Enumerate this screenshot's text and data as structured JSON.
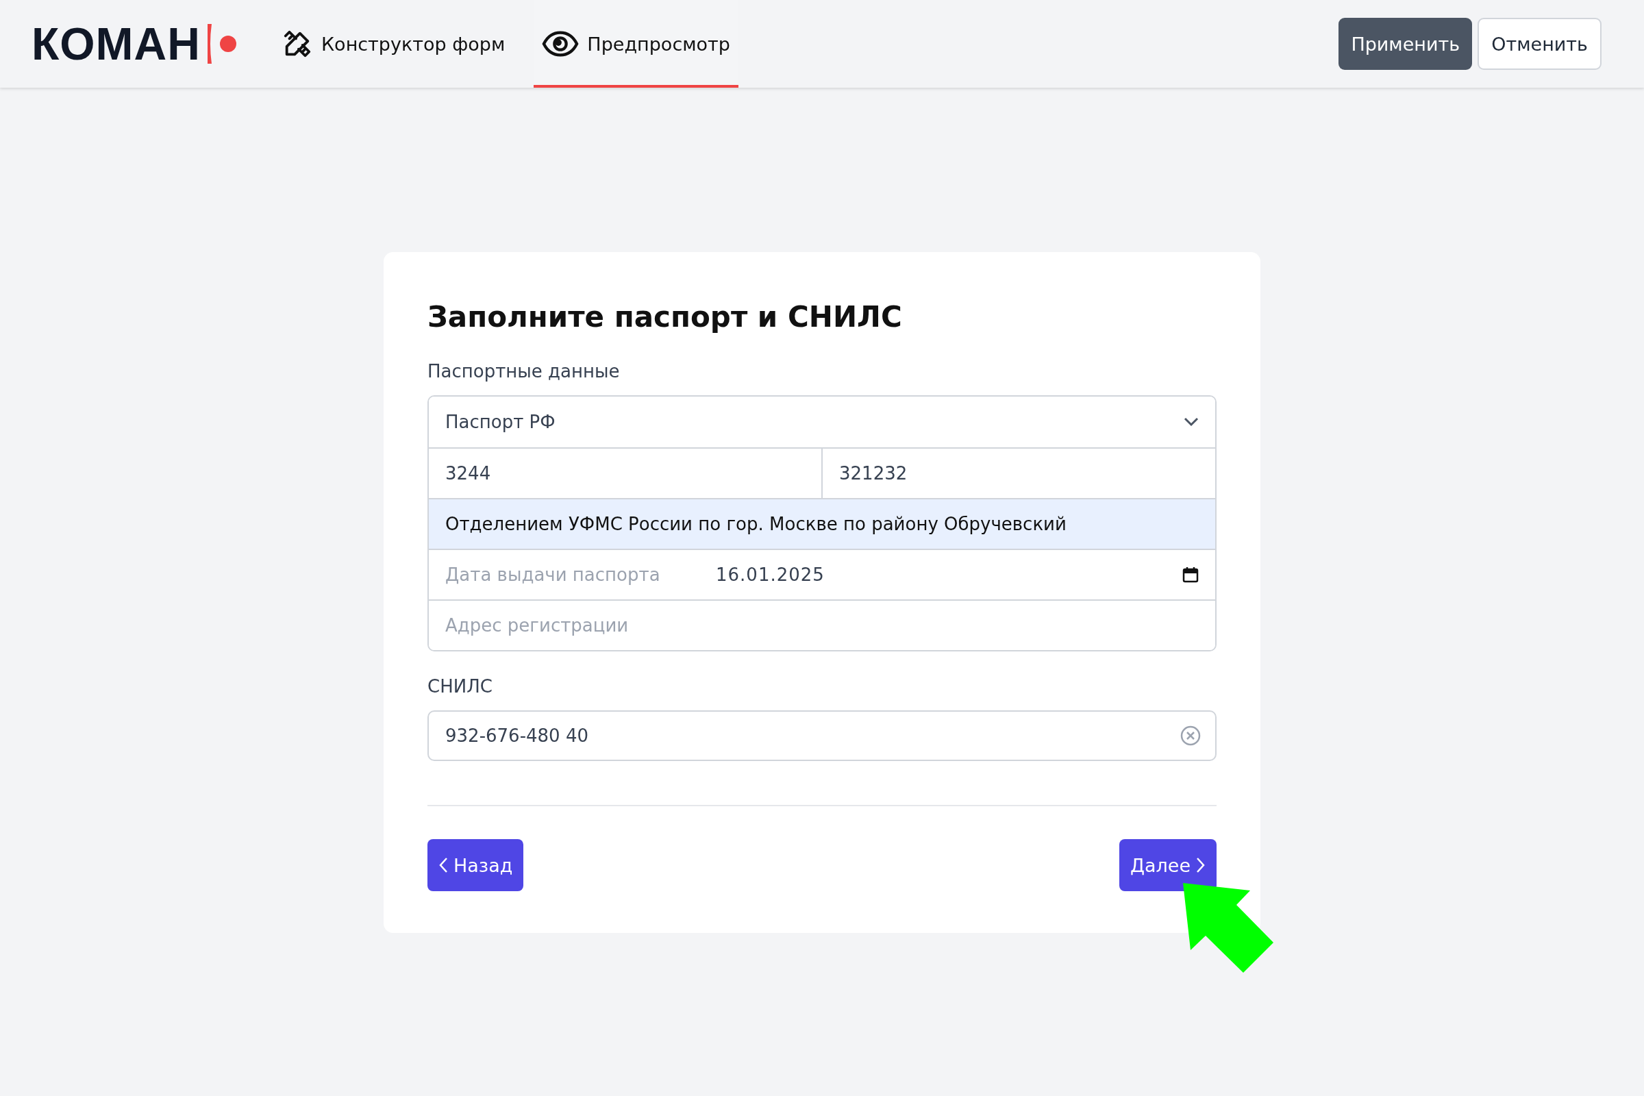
{
  "header": {
    "logo": "КОМАН",
    "tabs": [
      {
        "label": "Конструктор форм",
        "selected": false
      },
      {
        "label": "Предпросмотр",
        "selected": true
      }
    ],
    "actions": [
      {
        "label": "Применить",
        "kind": "primary"
      },
      {
        "label": "Отменить",
        "kind": "secondary"
      }
    ]
  },
  "form": {
    "title": "Заполните паспорт и СНИЛС",
    "passport": {
      "label": "Паспортные данные",
      "document_type": "Паспорт РФ",
      "series": "3244",
      "number": "321232",
      "issued_by": {
        "value": "Отделением УФМС России по гор. Москве по району Обручевский",
        "highlighted": true
      },
      "issue_date": {
        "label": "Дата выдачи паспорта",
        "value": "16.01.2025"
      },
      "address": {
        "placeholder": "Адрес регистрации"
      }
    },
    "snils": {
      "label": "СНИЛС",
      "value": "932-676-480 40"
    },
    "nav": {
      "back": "Назад",
      "next": "Далее"
    }
  },
  "annotation": {
    "kind": "arrow"
  }
}
